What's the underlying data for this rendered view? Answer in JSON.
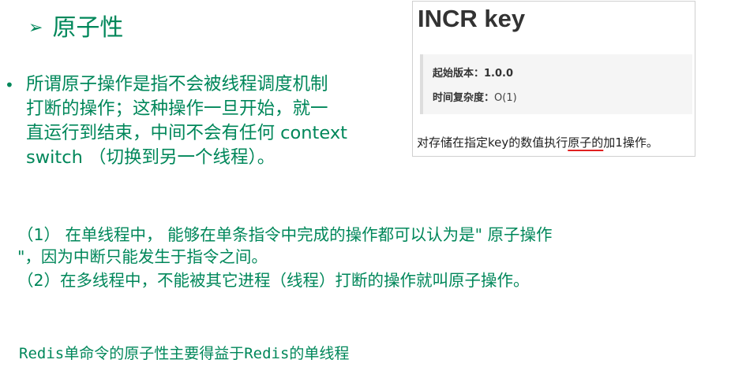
{
  "heading": {
    "arrow_glyph": "➢",
    "text": "原子性"
  },
  "bullet": {
    "glyph": "•",
    "lines": [
      "所谓原子操作是指不会被线程调度机制",
      "打断的操作；这种操作一旦开始，就一",
      "直运行到结束，中间不会有任何 context",
      "switch （切换到另一个线程）。"
    ]
  },
  "redis_card": {
    "title": "INCR key",
    "since_label": "起始版本：",
    "since_value": "1.0.0",
    "complexity_label": "时间复杂度：",
    "complexity_value": "O(1)",
    "desc_before": "对存储在指定key的数值执行",
    "desc_underlined": "原子的",
    "desc_after": "加1操作。",
    "underline_color": "#e02020"
  },
  "paragraphs": {
    "line1": "（1）  在单线程中， 能够在单条指令中完成的操作都可以认为是\" 原子操作",
    "line2": "\"，因为中断只能发生于指令之间。",
    "line3": "（2）在多线程中，不能被其它进程（线程）打断的操作就叫原子操作。"
  },
  "footer": {
    "text": "Redis单命令的原子性主要得益于Redis的单线程"
  },
  "colors": {
    "text_green": "#00875a",
    "card_border": "#d0d0d0",
    "meta_bg": "#f5f5f5"
  }
}
